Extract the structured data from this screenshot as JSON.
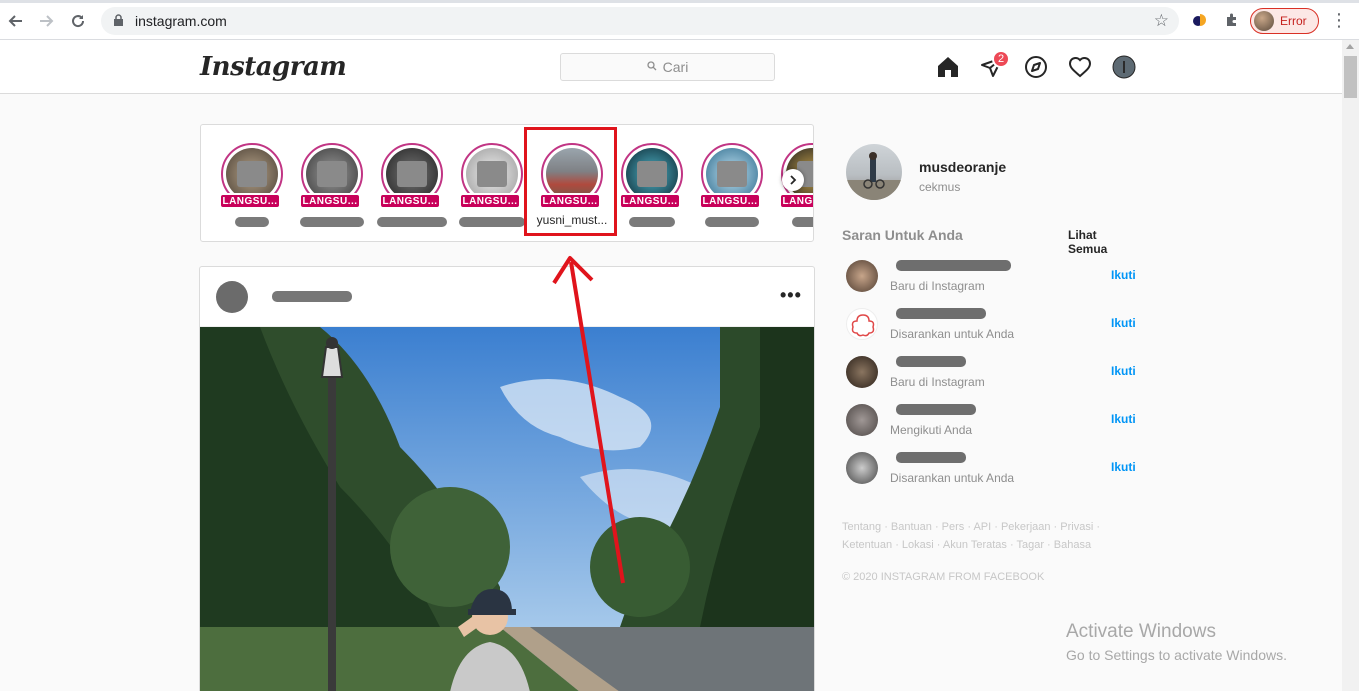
{
  "browser": {
    "url": "instagram.com",
    "profile_status": "Error",
    "colors": {
      "error": "#d93025"
    }
  },
  "header": {
    "logo": "Instagram",
    "search_placeholder": "Cari",
    "dm_badge": "2",
    "icons": [
      "home-icon",
      "direct-icon",
      "explore-icon",
      "activity-heart-icon",
      "profile-avatar"
    ]
  },
  "stories": {
    "live_label": "LANGSU...",
    "items": [
      {
        "username": ""
      },
      {
        "username": ""
      },
      {
        "username": ""
      },
      {
        "username": ""
      },
      {
        "username": "yusni_must..."
      },
      {
        "username": ""
      },
      {
        "username": ""
      },
      {
        "username": ""
      }
    ]
  },
  "post": {
    "username": ""
  },
  "sidebar": {
    "me": {
      "username": "musdeoranje",
      "fullname": "cekmus"
    },
    "suggestions_title": "Saran Untuk Anda",
    "see_all": "Lihat Semua",
    "follow_label": "Ikuti",
    "suggestions": [
      {
        "name": "",
        "reason": "Baru di Instagram"
      },
      {
        "name": "",
        "reason": "Disarankan untuk Anda"
      },
      {
        "name": "",
        "reason": "Baru di Instagram"
      },
      {
        "name": "",
        "reason": "Mengikuti Anda"
      },
      {
        "name": "",
        "reason": "Disarankan untuk Anda"
      }
    ],
    "footer_links": "Tentang · Bantuan · Pers · API · Pekerjaan · Privasi · Ketentuan · Lokasi · Akun Teratas · Tagar · Bahasa",
    "copyright": "© 2020 INSTAGRAM FROM FACEBOOK"
  },
  "watermark": {
    "title": "Activate Windows",
    "subtitle": "Go to Settings to activate Windows."
  },
  "colors": {
    "live_badge": "#c8005a",
    "story_ring": "#c13584",
    "follow": "#0095f6",
    "annotation": "#e0141c"
  }
}
